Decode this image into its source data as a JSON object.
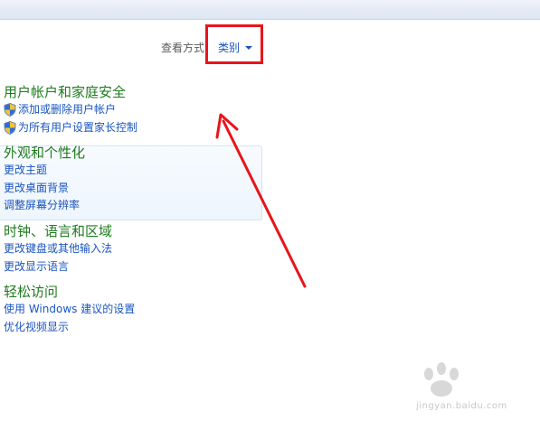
{
  "header": {
    "view_by_label": "查看方式",
    "view_by_value": "类别"
  },
  "sections": [
    {
      "title": "用户帐户和家庭安全",
      "links": [
        "添加或删除用户帐户",
        "为所有用户设置家长控制"
      ]
    },
    {
      "title": "外观和个性化",
      "links": [
        "更改主题",
        "更改桌面背景",
        "调整屏幕分辨率"
      ]
    },
    {
      "title": "时钟、语言和区域",
      "links": [
        "更改键盘或其他输入法",
        "更改显示语言"
      ]
    },
    {
      "title": "轻松访问",
      "links": [
        "使用 Windows 建议的设置",
        "优化视频显示"
      ]
    }
  ],
  "watermark": {
    "text": "jingyan.baidu.com"
  },
  "colors": {
    "link": "#1a55c0",
    "section_title": "#1e7b1e",
    "annotation_red": "#e8141c"
  }
}
